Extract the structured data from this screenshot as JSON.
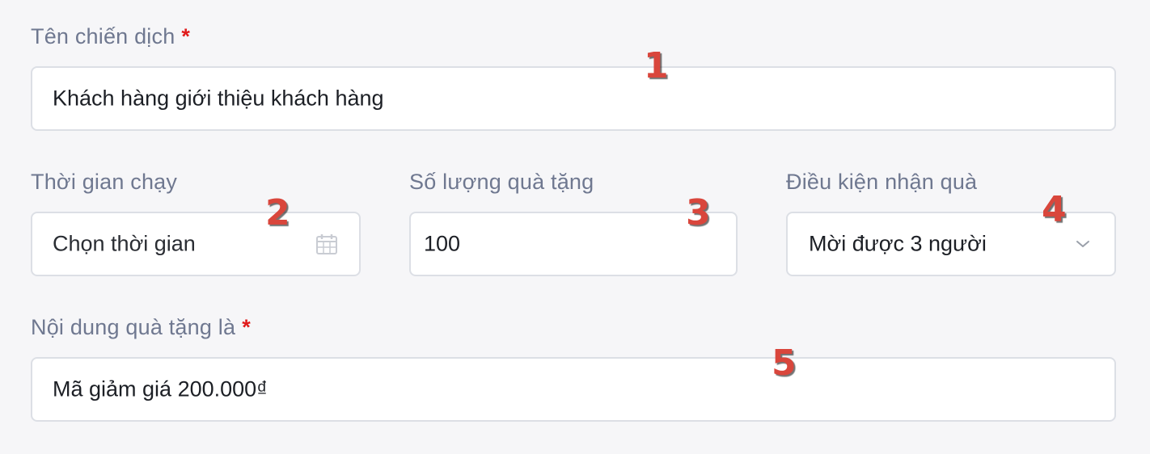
{
  "campaign_name": {
    "label": "Tên chiến dịch",
    "required": "*",
    "value": "Khách hàng giới thiệu khách hàng"
  },
  "run_time": {
    "label": "Thời gian chạy",
    "placeholder": "Chọn thời gian",
    "icon": "calendar-icon"
  },
  "gift_quantity": {
    "label": "Số lượng quà tặng",
    "value": "100"
  },
  "gift_condition": {
    "label": "Điều kiện nhận quà",
    "selected": "Mời được 3 người",
    "icon": "chevron-down-icon"
  },
  "gift_content": {
    "label": "Nội dung quà tặng là",
    "required": "*",
    "value": "Mã giảm giá 200.000₫"
  },
  "annotations": [
    "1",
    "2",
    "3",
    "4",
    "5"
  ],
  "colors": {
    "background": "#f6f6f8",
    "label": "#6f7890",
    "required": "#e01b1b",
    "marker": "#d9463c",
    "border": "#dcdfe5"
  }
}
